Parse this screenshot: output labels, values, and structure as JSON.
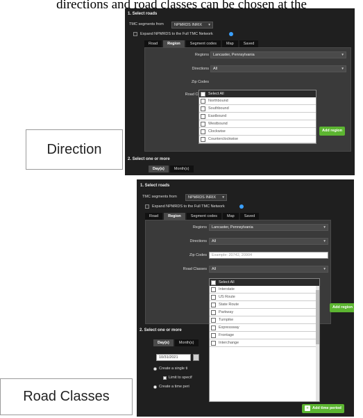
{
  "caption": "directions and road classes can be chosen at the",
  "labels": {
    "direction": "Direction",
    "road_classes": "Road Classes"
  },
  "panel1": {
    "section_title": "1. Select roads",
    "tmc_label": "TMC segments from",
    "tmc_value": "NPMRDS INRIX",
    "expand_text": "Expand NPMRDS to the Full TMC Network",
    "tabs": [
      "Road",
      "Region",
      "Segment codes",
      "Map",
      "Saved"
    ],
    "regions_label": "Regions",
    "regions_value": "Lancaster, Pennsylvania",
    "directions_label": "Directions",
    "directions_value": "All",
    "zip_label": "Zip Codes",
    "road_classes_label": "Road Classes",
    "dropdown_select_all": "Select All",
    "dropdown_items": [
      "Northbound",
      "Southbound",
      "Eastbound",
      "Westbound",
      "Clockwise",
      "Counterclockwise"
    ],
    "add_region": "Add region",
    "section2_title": "2. Select one or more",
    "date_tabs": [
      "Day(s)",
      "Month(s)"
    ]
  },
  "panel2": {
    "section_title": "1. Select roads",
    "tmc_label": "TMC segments from",
    "tmc_value": "NPMRDS INRIX",
    "expand_text": "Expand NPMRDS to the Full TMC Network",
    "tabs": [
      "Road",
      "Region",
      "Segment codes",
      "Map",
      "Saved"
    ],
    "regions_label": "Regions",
    "regions_value": "Lancaster, Pennsylvania",
    "directions_label": "Directions",
    "directions_value": "All",
    "zip_label": "Zip Codes",
    "zip_placeholder": "Example: 20742, 20904",
    "road_classes_label": "Road Classes",
    "road_classes_value": "All",
    "dropdown_select_all": "Select All",
    "dropdown_items": [
      "Interstate",
      "US Route",
      "State Route",
      "Parkway",
      "Turnpike",
      "Expressway",
      "Frontage",
      "Interchange"
    ],
    "add_region": "Add region",
    "section2_title": "2. Select one or more",
    "date_tabs": [
      "Day(s)",
      "Month(s)"
    ],
    "date_value": "10/31/2021",
    "option_single": "Create a single ti",
    "option_limit": "Limit to specif",
    "option_period": "Create a time peri",
    "add_time_period": "Add time period"
  }
}
